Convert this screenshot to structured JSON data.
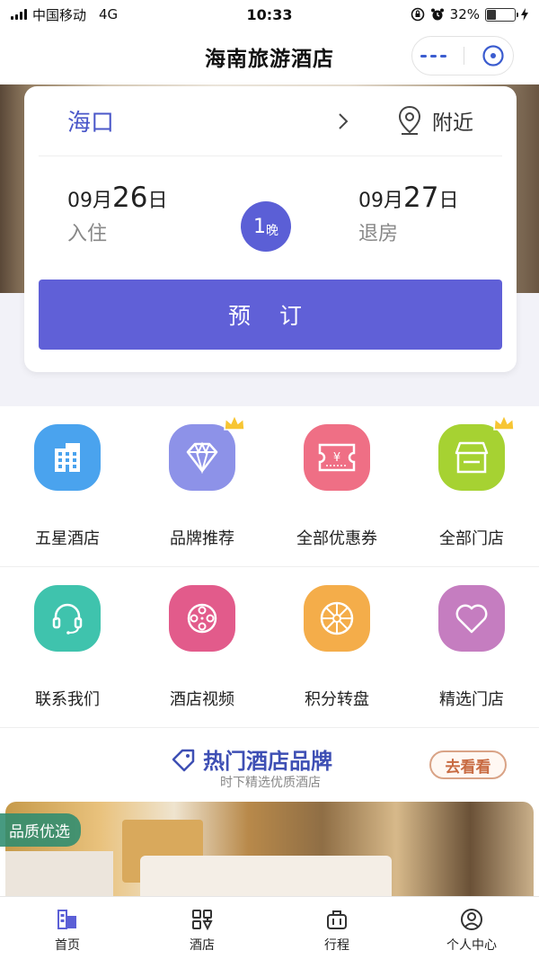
{
  "status_bar": {
    "carrier": "中国移动",
    "network": "4G",
    "time": "10:33",
    "battery": "32%",
    "battery_level": 0.32
  },
  "nav": {
    "title": "海南旅游酒店"
  },
  "booking": {
    "city": "海口",
    "nearby_label": "附近",
    "checkin": {
      "month": "09月",
      "day": "26",
      "suffix": "日",
      "label": "入住"
    },
    "checkout": {
      "month": "09月",
      "day": "27",
      "suffix": "日",
      "label": "退房"
    },
    "nights_count": "1",
    "nights_unit": "晚",
    "book_label": "预 订"
  },
  "grid_row1": [
    {
      "label": "五星酒店",
      "icon": "building-icon",
      "color": "#4aa3ee"
    },
    {
      "label": "品牌推荐",
      "icon": "diamond-icon",
      "color": "#8d92e8",
      "crown": true
    },
    {
      "label": "全部优惠券",
      "icon": "coupon-icon",
      "color": "#ef6f85"
    },
    {
      "label": "全部门店",
      "icon": "store-icon",
      "color": "#a6d232",
      "crown": true
    }
  ],
  "grid_row2": [
    {
      "label": "联系我们",
      "icon": "headset-icon",
      "color": "#3fc3ad"
    },
    {
      "label": "酒店视频",
      "icon": "film-reel-icon",
      "color": "#e25b8b"
    },
    {
      "label": "积分转盘",
      "icon": "wheel-icon",
      "color": "#f4ad4a"
    },
    {
      "label": "精选门店",
      "icon": "heart-icon",
      "color": "#c57dc0"
    }
  ],
  "brand_banner": {
    "title": "热门酒店品牌",
    "subtitle": "时下精选优质酒店",
    "button_label": "去看看"
  },
  "featured": {
    "tag": "品质优选"
  },
  "tab_bar": [
    {
      "label": "首页",
      "icon": "home-icon",
      "active": true
    },
    {
      "label": "酒店",
      "icon": "hotel-icon",
      "active": false
    },
    {
      "label": "行程",
      "icon": "luggage-icon",
      "active": false
    },
    {
      "label": "个人中心",
      "icon": "user-icon",
      "active": false
    }
  ],
  "colors": {
    "accent": "#6060d7",
    "city_blue": "#4a57c9",
    "brand_blue": "#3e4fb4"
  }
}
